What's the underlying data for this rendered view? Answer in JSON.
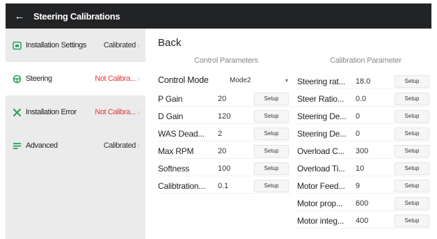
{
  "header": {
    "title": "Steering Calibrations"
  },
  "sidebar": {
    "items": [
      {
        "label": "Installation Settings",
        "status": "Calibrated",
        "icon": "installation-icon",
        "status_color": "#333333"
      },
      {
        "label": "Steering",
        "status": "Not Calibra...",
        "icon": "steering-wheel-icon",
        "status_color": "#e23838"
      },
      {
        "label": "Installation Error",
        "status": "Not Calibra...",
        "icon": "tools-icon",
        "status_color": "#e23838"
      },
      {
        "label": "Advanced",
        "status": "Calibrated",
        "icon": "advanced-list-icon",
        "status_color": "#333333"
      }
    ]
  },
  "main": {
    "back_label": "Back",
    "control": {
      "title": "Control Parameters",
      "mode": {
        "label": "Control Mode",
        "value": "Mode2"
      },
      "rows": [
        {
          "label": "P Gain",
          "value": "20",
          "button": "Setup"
        },
        {
          "label": "D Gain",
          "value": "120",
          "button": "Setup"
        },
        {
          "label": "WAS Dead...",
          "value": "2",
          "button": "Setup"
        },
        {
          "label": "Max RPM",
          "value": "20",
          "button": "Setup"
        },
        {
          "label": "Softness",
          "value": "100",
          "button": "Setup"
        },
        {
          "label": "Calibtration...",
          "value": "0.1",
          "button": "Setup"
        }
      ]
    },
    "calibration": {
      "title": "Calibration Parameter",
      "rows": [
        {
          "label": "Steering rat...",
          "value": "18.0",
          "button": "Setup"
        },
        {
          "label": "Steer Ratio...",
          "value": "0.0",
          "button": "Setup"
        },
        {
          "label": "Steering De...",
          "value": "0",
          "button": "Setup"
        },
        {
          "label": "Steering De...",
          "value": "0",
          "button": "Setup"
        },
        {
          "label": "Overload C...",
          "value": "300",
          "button": "Setup"
        },
        {
          "label": "Overload Ti...",
          "value": "10",
          "button": "Setup"
        },
        {
          "label": "Motor Feed...",
          "value": "9",
          "button": "Setup"
        },
        {
          "label": "Motor prop...",
          "value": "600",
          "button": "Setup"
        },
        {
          "label": "Motor integ...",
          "value": "400",
          "button": "Setup"
        }
      ]
    }
  }
}
